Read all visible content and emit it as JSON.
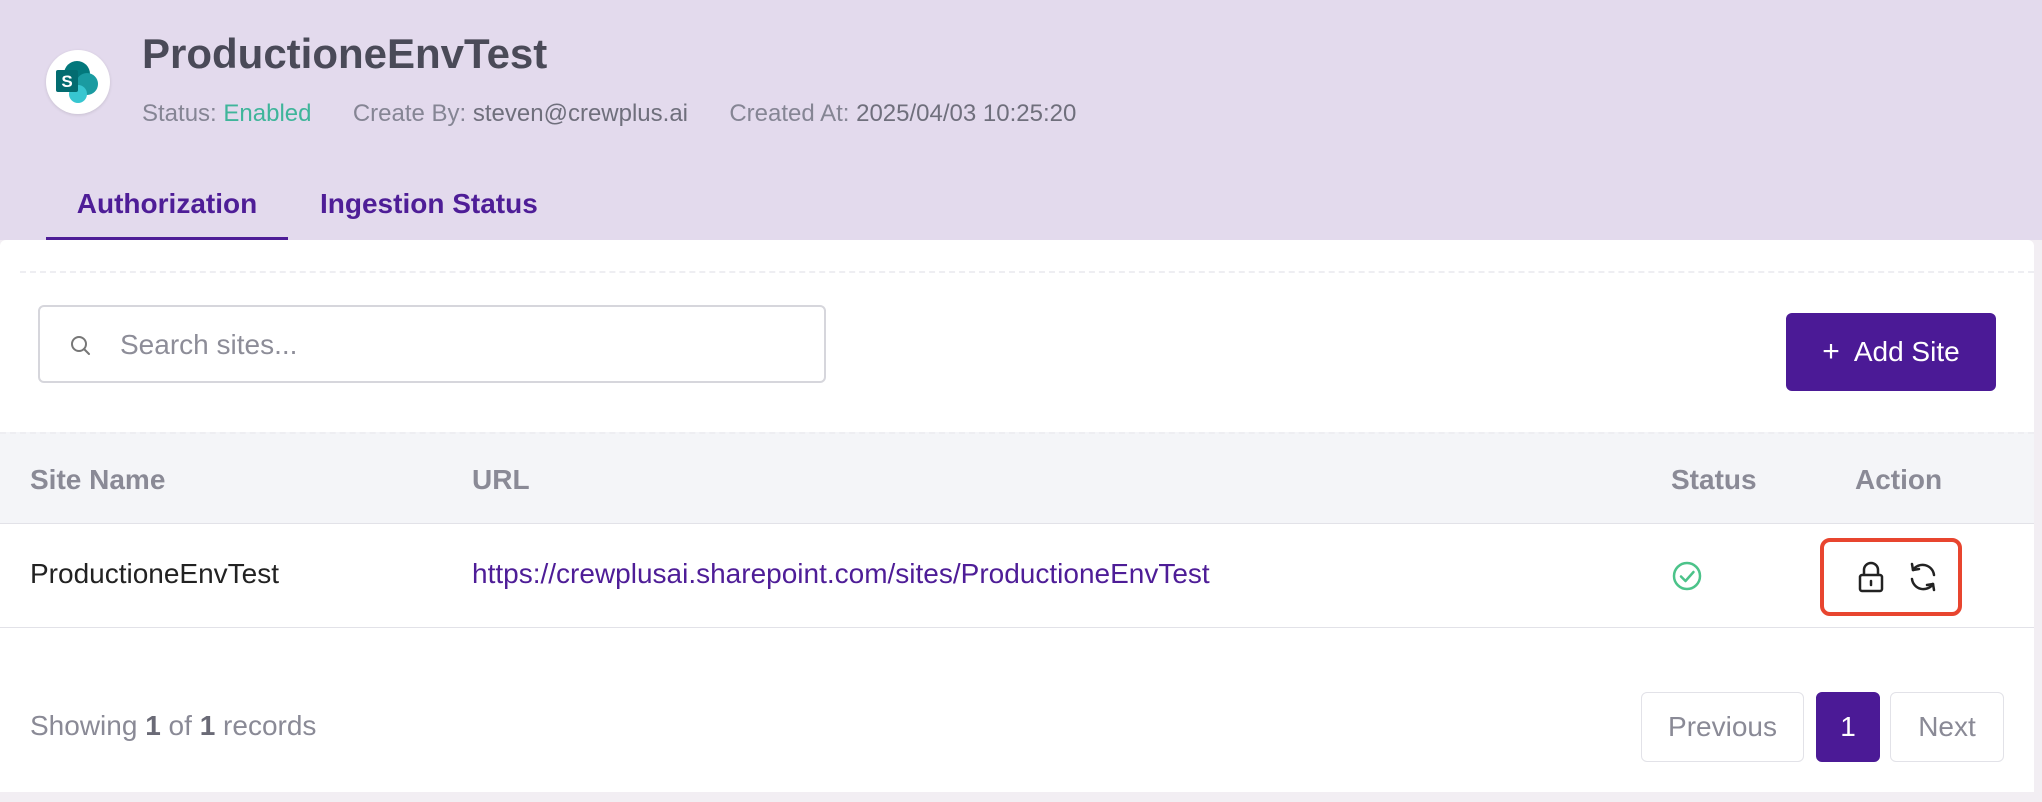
{
  "header": {
    "title": "ProductioneEnvTest",
    "logo_icon": "sharepoint-icon",
    "status_label": "Status:",
    "status_value": "Enabled",
    "created_by_label": "Create By:",
    "created_by_value": "steven@crewplus.ai",
    "created_at_label": "Created At:",
    "created_at_value": "2025/04/03 10:25:20",
    "status_color": "#3fb59a"
  },
  "tabs": [
    {
      "label": "Authorization",
      "active": true
    },
    {
      "label": "Ingestion Status",
      "active": false
    }
  ],
  "toolbar": {
    "search_placeholder": "Search sites...",
    "search_value": "",
    "add_button_label": "Add Site",
    "add_button_icon": "plus-icon"
  },
  "table": {
    "columns": [
      "Site Name",
      "URL",
      "Status",
      "Action"
    ],
    "rows": [
      {
        "site_name": "ProductioneEnvTest",
        "url": "https://crewplusai.sharepoint.com/sites/ProductioneEnvTest",
        "status_icon": "check-circle-icon",
        "actions": [
          "lock-icon",
          "refresh-icon"
        ]
      }
    ]
  },
  "footer": {
    "showing_prefix": "Showing",
    "from": "1",
    "of_label": "of",
    "total": "1",
    "records_label": "records"
  },
  "pagination": {
    "previous_label": "Previous",
    "current_page": "1",
    "next_label": "Next"
  },
  "colors": {
    "accent": "#4b1a96",
    "header_bg": "#e3daed",
    "highlight_border": "#e8452f"
  }
}
